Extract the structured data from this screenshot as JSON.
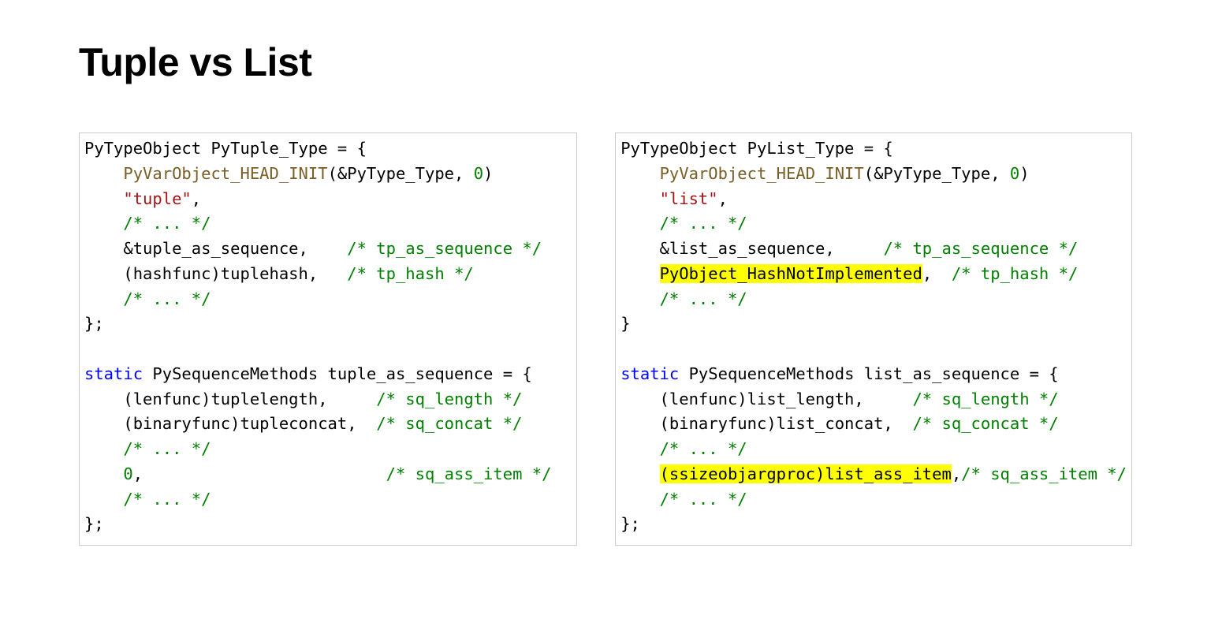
{
  "title": "Tuple vs List",
  "left": {
    "l0a": "PyTypeObject PyTuple_Type = {",
    "l1_fn": "PyVarObject_HEAD_INIT",
    "l1_rest": "(&PyType_Type, ",
    "l1_num": "0",
    "l1_close": ")",
    "l2_str": "\"tuple\"",
    "l2_comma": ",",
    "l3_cm": "/* ... */",
    "l4_a": "    &tuple_as_sequence,    ",
    "l4_cm": "/* tp_as_sequence */",
    "l5_a": "    (hashfunc)tuplehash,   ",
    "l5_cm": "/* tp_hash */",
    "l6_cm": "/* ... */",
    "l7": "};",
    "l9_kw": "static",
    "l9_rest": " PySequenceMethods tuple_as_sequence = {",
    "l10_a": "    (lenfunc)tuplelength,     ",
    "l10_cm": "/* sq_length */",
    "l11_a": "    (binaryfunc)tupleconcat,  ",
    "l11_cm": "/* sq_concat */",
    "l12_cm": "/* ... */",
    "l13_num": "0",
    "l13_comma": ",                         ",
    "l13_cm": "/* sq_ass_item */",
    "l14_cm": "/* ... */",
    "l15": "};"
  },
  "right": {
    "l0a": "PyTypeObject PyList_Type = {",
    "l1_fn": "PyVarObject_HEAD_INIT",
    "l1_rest": "(&PyType_Type, ",
    "l1_num": "0",
    "l1_close": ")",
    "l2_str": "\"list\"",
    "l2_comma": ",",
    "l3_cm": "/* ... */",
    "l4_a": "    &list_as_sequence,     ",
    "l4_cm": "/* tp_as_sequence */",
    "l5_pre": "    ",
    "l5_hl": "PyObject_HashNotImplemented",
    "l5_post": ",  ",
    "l5_cm": "/* tp_hash */",
    "l6_cm": "/* ... */",
    "l7": "}",
    "l9_kw": "static",
    "l9_rest": " PySequenceMethods list_as_sequence = {",
    "l10_a": "    (lenfunc)list_length,     ",
    "l10_cm": "/* sq_length */",
    "l11_a": "    (binaryfunc)list_concat,  ",
    "l11_cm": "/* sq_concat */",
    "l12_cm": "/* ... */",
    "l13_pre": "    ",
    "l13_hl": "(ssizeobjargproc)list_ass_item",
    "l13_post": ",",
    "l13_cm": "/* sq_ass_item */",
    "l14_cm": "/* ... */",
    "l15": "};"
  }
}
